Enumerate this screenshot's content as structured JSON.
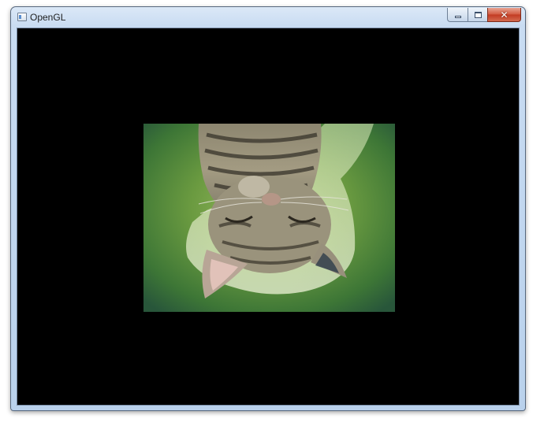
{
  "window": {
    "title": "OpenGL",
    "icon": "opengl-app-icon",
    "caption_buttons": {
      "minimize_icon": "minimize-icon",
      "maximize_icon": "maximize-icon",
      "close_icon": "close-icon",
      "close_glyph": "✕"
    }
  },
  "viewport": {
    "background_color": "#000000",
    "content": "upside-down-kitten-texture"
  }
}
